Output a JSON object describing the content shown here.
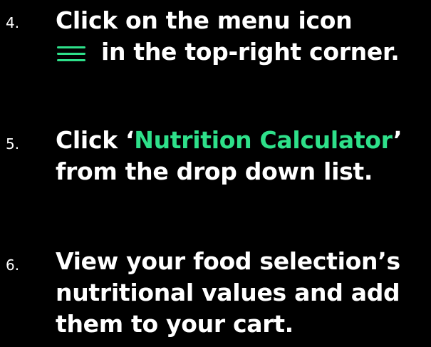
{
  "colors": {
    "background": "#000000",
    "text": "#ffffff",
    "accent": "#2ee08a"
  },
  "steps": [
    {
      "number": "4.",
      "line1": "Click on the menu icon",
      "icon": "hamburger-menu-icon",
      "line2": "in the top-right corner."
    },
    {
      "number": "5.",
      "line1_prefix": "Click ‘",
      "line1_highlight": "Nutrition Calculator",
      "line1_suffix": "’",
      "line2": "from the drop down list."
    },
    {
      "number": "6.",
      "line1": "View your food selection’s",
      "line2": "nutritional values and add",
      "line3": "them to your cart."
    }
  ]
}
